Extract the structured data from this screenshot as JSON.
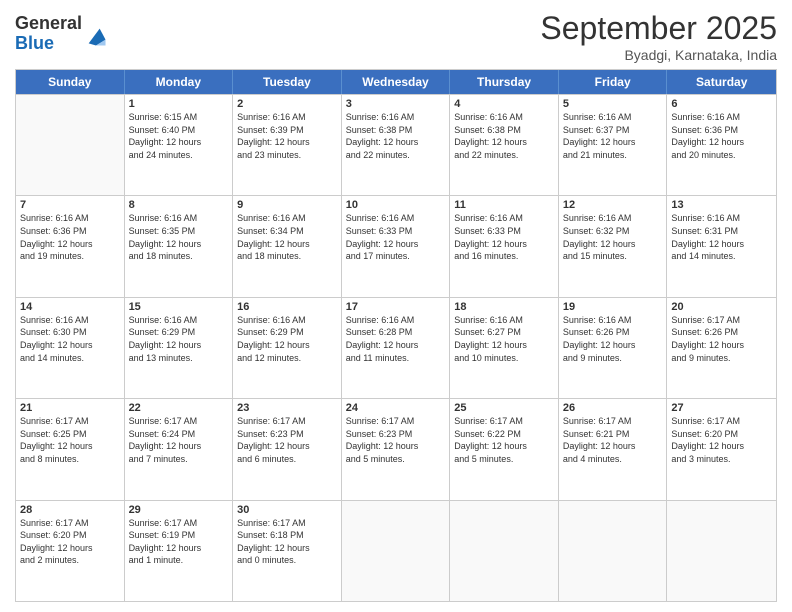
{
  "logo": {
    "line1": "General",
    "line2": "Blue"
  },
  "header": {
    "title": "September 2025",
    "subtitle": "Byadgi, Karnataka, India"
  },
  "weekdays": [
    "Sunday",
    "Monday",
    "Tuesday",
    "Wednesday",
    "Thursday",
    "Friday",
    "Saturday"
  ],
  "rows": [
    [
      {
        "day": "",
        "info": ""
      },
      {
        "day": "1",
        "info": "Sunrise: 6:15 AM\nSunset: 6:40 PM\nDaylight: 12 hours\nand 24 minutes."
      },
      {
        "day": "2",
        "info": "Sunrise: 6:16 AM\nSunset: 6:39 PM\nDaylight: 12 hours\nand 23 minutes."
      },
      {
        "day": "3",
        "info": "Sunrise: 6:16 AM\nSunset: 6:38 PM\nDaylight: 12 hours\nand 22 minutes."
      },
      {
        "day": "4",
        "info": "Sunrise: 6:16 AM\nSunset: 6:38 PM\nDaylight: 12 hours\nand 22 minutes."
      },
      {
        "day": "5",
        "info": "Sunrise: 6:16 AM\nSunset: 6:37 PM\nDaylight: 12 hours\nand 21 minutes."
      },
      {
        "day": "6",
        "info": "Sunrise: 6:16 AM\nSunset: 6:36 PM\nDaylight: 12 hours\nand 20 minutes."
      }
    ],
    [
      {
        "day": "7",
        "info": "Sunrise: 6:16 AM\nSunset: 6:36 PM\nDaylight: 12 hours\nand 19 minutes."
      },
      {
        "day": "8",
        "info": "Sunrise: 6:16 AM\nSunset: 6:35 PM\nDaylight: 12 hours\nand 18 minutes."
      },
      {
        "day": "9",
        "info": "Sunrise: 6:16 AM\nSunset: 6:34 PM\nDaylight: 12 hours\nand 18 minutes."
      },
      {
        "day": "10",
        "info": "Sunrise: 6:16 AM\nSunset: 6:33 PM\nDaylight: 12 hours\nand 17 minutes."
      },
      {
        "day": "11",
        "info": "Sunrise: 6:16 AM\nSunset: 6:33 PM\nDaylight: 12 hours\nand 16 minutes."
      },
      {
        "day": "12",
        "info": "Sunrise: 6:16 AM\nSunset: 6:32 PM\nDaylight: 12 hours\nand 15 minutes."
      },
      {
        "day": "13",
        "info": "Sunrise: 6:16 AM\nSunset: 6:31 PM\nDaylight: 12 hours\nand 14 minutes."
      }
    ],
    [
      {
        "day": "14",
        "info": "Sunrise: 6:16 AM\nSunset: 6:30 PM\nDaylight: 12 hours\nand 14 minutes."
      },
      {
        "day": "15",
        "info": "Sunrise: 6:16 AM\nSunset: 6:29 PM\nDaylight: 12 hours\nand 13 minutes."
      },
      {
        "day": "16",
        "info": "Sunrise: 6:16 AM\nSunset: 6:29 PM\nDaylight: 12 hours\nand 12 minutes."
      },
      {
        "day": "17",
        "info": "Sunrise: 6:16 AM\nSunset: 6:28 PM\nDaylight: 12 hours\nand 11 minutes."
      },
      {
        "day": "18",
        "info": "Sunrise: 6:16 AM\nSunset: 6:27 PM\nDaylight: 12 hours\nand 10 minutes."
      },
      {
        "day": "19",
        "info": "Sunrise: 6:16 AM\nSunset: 6:26 PM\nDaylight: 12 hours\nand 9 minutes."
      },
      {
        "day": "20",
        "info": "Sunrise: 6:17 AM\nSunset: 6:26 PM\nDaylight: 12 hours\nand 9 minutes."
      }
    ],
    [
      {
        "day": "21",
        "info": "Sunrise: 6:17 AM\nSunset: 6:25 PM\nDaylight: 12 hours\nand 8 minutes."
      },
      {
        "day": "22",
        "info": "Sunrise: 6:17 AM\nSunset: 6:24 PM\nDaylight: 12 hours\nand 7 minutes."
      },
      {
        "day": "23",
        "info": "Sunrise: 6:17 AM\nSunset: 6:23 PM\nDaylight: 12 hours\nand 6 minutes."
      },
      {
        "day": "24",
        "info": "Sunrise: 6:17 AM\nSunset: 6:23 PM\nDaylight: 12 hours\nand 5 minutes."
      },
      {
        "day": "25",
        "info": "Sunrise: 6:17 AM\nSunset: 6:22 PM\nDaylight: 12 hours\nand 5 minutes."
      },
      {
        "day": "26",
        "info": "Sunrise: 6:17 AM\nSunset: 6:21 PM\nDaylight: 12 hours\nand 4 minutes."
      },
      {
        "day": "27",
        "info": "Sunrise: 6:17 AM\nSunset: 6:20 PM\nDaylight: 12 hours\nand 3 minutes."
      }
    ],
    [
      {
        "day": "28",
        "info": "Sunrise: 6:17 AM\nSunset: 6:20 PM\nDaylight: 12 hours\nand 2 minutes."
      },
      {
        "day": "29",
        "info": "Sunrise: 6:17 AM\nSunset: 6:19 PM\nDaylight: 12 hours\nand 1 minute."
      },
      {
        "day": "30",
        "info": "Sunrise: 6:17 AM\nSunset: 6:18 PM\nDaylight: 12 hours\nand 0 minutes."
      },
      {
        "day": "",
        "info": ""
      },
      {
        "day": "",
        "info": ""
      },
      {
        "day": "",
        "info": ""
      },
      {
        "day": "",
        "info": ""
      }
    ]
  ]
}
